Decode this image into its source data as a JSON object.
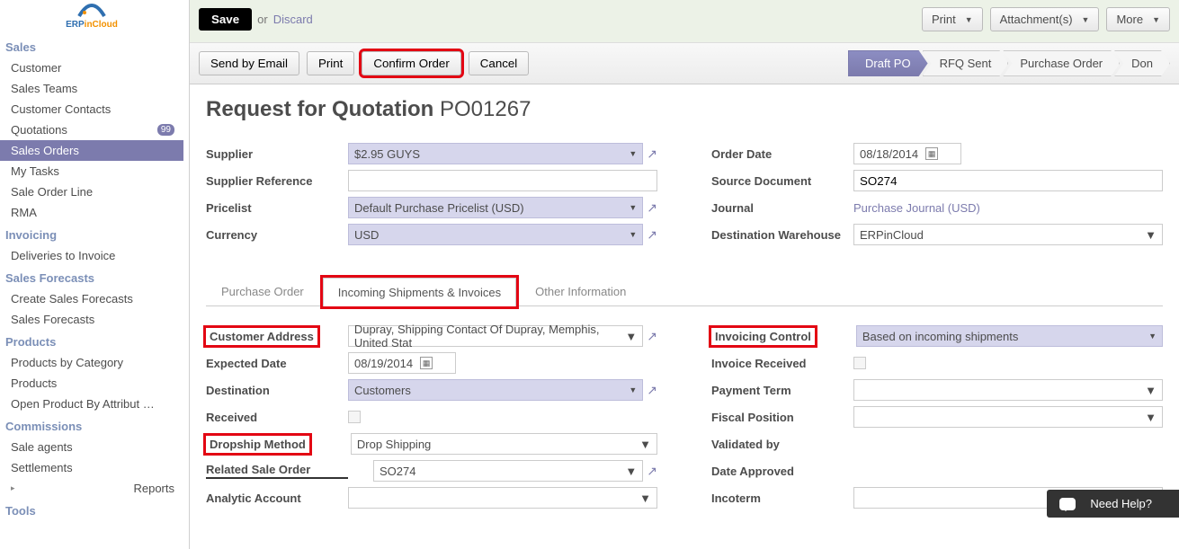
{
  "logo": {
    "brand": "ERP",
    "sub": "inCloud"
  },
  "sidebar": {
    "groups": [
      {
        "title": "Sales",
        "items": [
          {
            "label": "Customer"
          },
          {
            "label": "Sales Teams"
          },
          {
            "label": "Customer Contacts"
          },
          {
            "label": "Quotations",
            "badge": "99"
          },
          {
            "label": "Sales Orders",
            "active": true
          },
          {
            "label": "My Tasks"
          },
          {
            "label": "Sale Order Line"
          },
          {
            "label": "RMA"
          }
        ]
      },
      {
        "title": "Invoicing",
        "items": [
          {
            "label": "Deliveries to Invoice"
          }
        ]
      },
      {
        "title": "Sales Forecasts",
        "items": [
          {
            "label": "Create Sales Forecasts"
          },
          {
            "label": "Sales Forecasts"
          }
        ]
      },
      {
        "title": "Products",
        "items": [
          {
            "label": "Products by Category"
          },
          {
            "label": "Products"
          },
          {
            "label": "Open Product By Attribut …"
          }
        ]
      },
      {
        "title": "Commissions",
        "items": [
          {
            "label": "Sale agents"
          },
          {
            "label": "Settlements"
          },
          {
            "label": "Reports",
            "caret": true
          }
        ]
      },
      {
        "title": "Tools",
        "items": []
      }
    ]
  },
  "topbar": {
    "save": "Save",
    "or": "or",
    "discard": "Discard",
    "print": "Print",
    "attachments": "Attachment(s)",
    "more": "More"
  },
  "actionbar": {
    "send_email": "Send by Email",
    "print": "Print",
    "confirm": "Confirm Order",
    "cancel": "Cancel",
    "steps": [
      "Draft PO",
      "RFQ Sent",
      "Purchase Order",
      "Don"
    ]
  },
  "page": {
    "title": "Request for Quotation ",
    "code": "PO01267"
  },
  "form": {
    "left": {
      "supplier_label": "Supplier",
      "supplier": "$2.95 GUYS",
      "supplier_ref_label": "Supplier Reference",
      "supplier_ref": "",
      "pricelist_label": "Pricelist",
      "pricelist": "Default Purchase Pricelist (USD)",
      "currency_label": "Currency",
      "currency": "USD"
    },
    "right": {
      "order_date_label": "Order Date",
      "order_date": "08/18/2014",
      "source_doc_label": "Source Document",
      "source_doc": "SO274",
      "journal_label": "Journal",
      "journal": "Purchase Journal (USD)",
      "dest_wh_label": "Destination Warehouse",
      "dest_wh": "ERPinCloud"
    }
  },
  "tabs": {
    "t0": "Purchase Order",
    "t1": "Incoming Shipments & Invoices",
    "t2": "Other Information"
  },
  "tabform": {
    "left": {
      "cust_addr_label": "Customer Address",
      "cust_addr": "Dupray, Shipping Contact Of Dupray, Memphis, United Stat",
      "expected_label": "Expected Date",
      "expected": "08/19/2014",
      "destination_label": "Destination",
      "destination": "Customers",
      "received_label": "Received",
      "dropship_label": "Dropship Method",
      "dropship": "Drop Shipping",
      "related_so_label": "Related Sale Order",
      "related_so": "SO274",
      "analytic_label": "Analytic Account",
      "analytic": ""
    },
    "right": {
      "inv_ctrl_label": "Invoicing Control",
      "inv_ctrl": "Based on incoming shipments",
      "invoice_rec_label": "Invoice Received",
      "payment_term_label": "Payment Term",
      "payment_term": "",
      "fiscal_label": "Fiscal Position",
      "fiscal": "",
      "validated_label": "Validated by",
      "date_appr_label": "Date Approved",
      "incoterm_label": "Incoterm",
      "incoterm": ""
    }
  },
  "help": {
    "label": "Need Help?"
  }
}
